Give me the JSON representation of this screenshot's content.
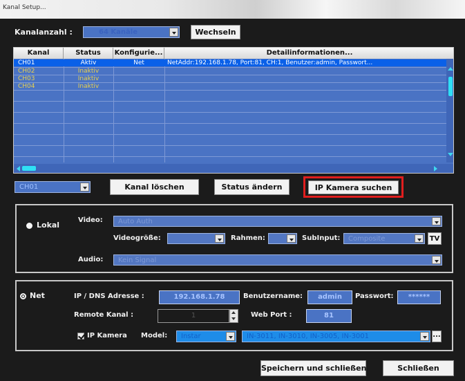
{
  "window": {
    "title": "Kanal Setup..."
  },
  "top": {
    "kanalanzahl_label": "Kanalanzahl :",
    "kanalanzahl_value": "64 Kanäle",
    "wechseln_label": "Wechseln"
  },
  "table": {
    "columns": [
      "Kanal",
      "Status",
      "Konfigurie...",
      "Detailinformationen..."
    ],
    "rows": [
      {
        "kanal": "CH01",
        "status": "Aktiv",
        "konfig": "Net",
        "detail": "NetAddr:192.168.1.78, Port:81, CH:1, Benutzer:admin, Passwort...",
        "selected": true
      },
      {
        "kanal": "CH02",
        "status": "Inaktiv",
        "konfig": "",
        "detail": "",
        "selected": false
      },
      {
        "kanal": "CH03",
        "status": "Inaktiv",
        "konfig": "",
        "detail": "",
        "selected": false
      },
      {
        "kanal": "CH04",
        "status": "Inaktiv",
        "konfig": "",
        "detail": "",
        "selected": false
      }
    ]
  },
  "actions": {
    "channel_select": "CH01",
    "kanal_loeschen": "Kanal löschen",
    "status_aendern": "Status ändern",
    "ip_kamera_suchen": "IP Kamera suchen"
  },
  "lokal": {
    "radio_label": "Lokal",
    "video_label": "Video:",
    "video_value": "Auto Auth",
    "videogroesse_label": "Videogröße:",
    "rahmen_label": "Rahmen:",
    "subinput_label": "SubInput:",
    "subinput_value": "Composite",
    "tv_label": "TV",
    "audio_label": "Audio:",
    "audio_value": "Kein Signal"
  },
  "net": {
    "radio_label": "Net",
    "ip_label": "IP / DNS Adresse :",
    "ip_value": "192.168.1.78",
    "benutzername_label": "Benutzername:",
    "benutzername_value": "admin",
    "passwort_label": "Passwort:",
    "passwort_value": "******",
    "remote_kanal_label": "Remote Kanal :",
    "remote_kanal_value": "1",
    "web_port_label": "Web Port :",
    "web_port_value": "81",
    "ip_kamera_label": "IP Kamera",
    "model_label": "Model:",
    "model_value": "Instar",
    "model_list_value": "IN-3011, IN-3010, IN-3005, IN-3001",
    "more_label": "..."
  },
  "footer": {
    "save_close": "Speichern und schließen",
    "close": "Schließen"
  },
  "colors": {
    "background": "#1b1b1b",
    "field_blue": "#4a73c4",
    "selection": "#0a60e8",
    "inactive_text": "#e8d050",
    "highlight": "#e01e1e"
  }
}
